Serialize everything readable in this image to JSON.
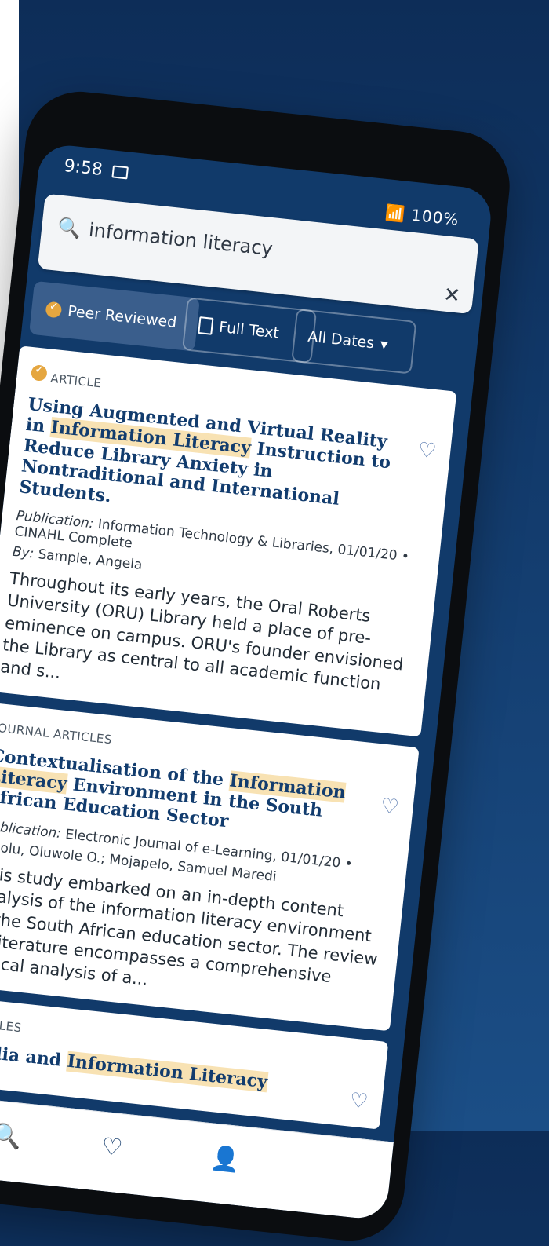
{
  "status_bar": {
    "time": "9:58",
    "right": "100%"
  },
  "search": {
    "query": "information literacy",
    "clear_icon": "close-icon",
    "icon": "search-icon"
  },
  "filters": [
    {
      "label": "Peer Reviewed",
      "icon": "peer-reviewed-badge-icon",
      "active": true
    },
    {
      "label": "Full Text",
      "icon": "document-icon",
      "active": false
    },
    {
      "label": "All Dates",
      "icon": "chevron-down-icon",
      "active": false
    }
  ],
  "results": [
    {
      "type": "ARTICLE",
      "title_pre": "Using Augmented and Virtual Reality in",
      "title_hl": "Information Literacy",
      "title_post": "Instruction to Reduce Library Anxiety in Nontraditional and International Students.",
      "publication_label": "Publication:",
      "publication": "Information Technology & Libraries, 01/01/20 • CINAHL Complete",
      "by_label": "By:",
      "authors": "Sample, Angela",
      "abstract": "Throughout its early years, the Oral Roberts University (ORU) Library held a place of pre-eminence on campus. ORU's founder envisioned the Library as central to all academic function and s..."
    },
    {
      "type": "JOURNAL ARTICLES",
      "title_pre": "Contextualisation of the",
      "title_hl": "Information Literacy",
      "title_post": "Environment in the South African Education Sector",
      "publication_label": "Publication:",
      "publication": "Electronic Journal of e-Learning, 01/01/20 •",
      "by_label": "",
      "authors": "Odolu, Oluwole O.; Mojapelo, Samuel Maredi",
      "abstract": "This study embarked on an in-depth content analysis of the information literacy environment in the South African education sector. The review of literature encompasses a comprehensive critical analysis of a..."
    },
    {
      "type": "ARTICLES",
      "title_pre": "Media and",
      "title_hl": "Information Literacy",
      "title_post": ""
    }
  ],
  "bottom_nav": {
    "search_icon": "search-icon",
    "favorites_icon": "heart-icon",
    "profile_icon": "profile-icon"
  }
}
